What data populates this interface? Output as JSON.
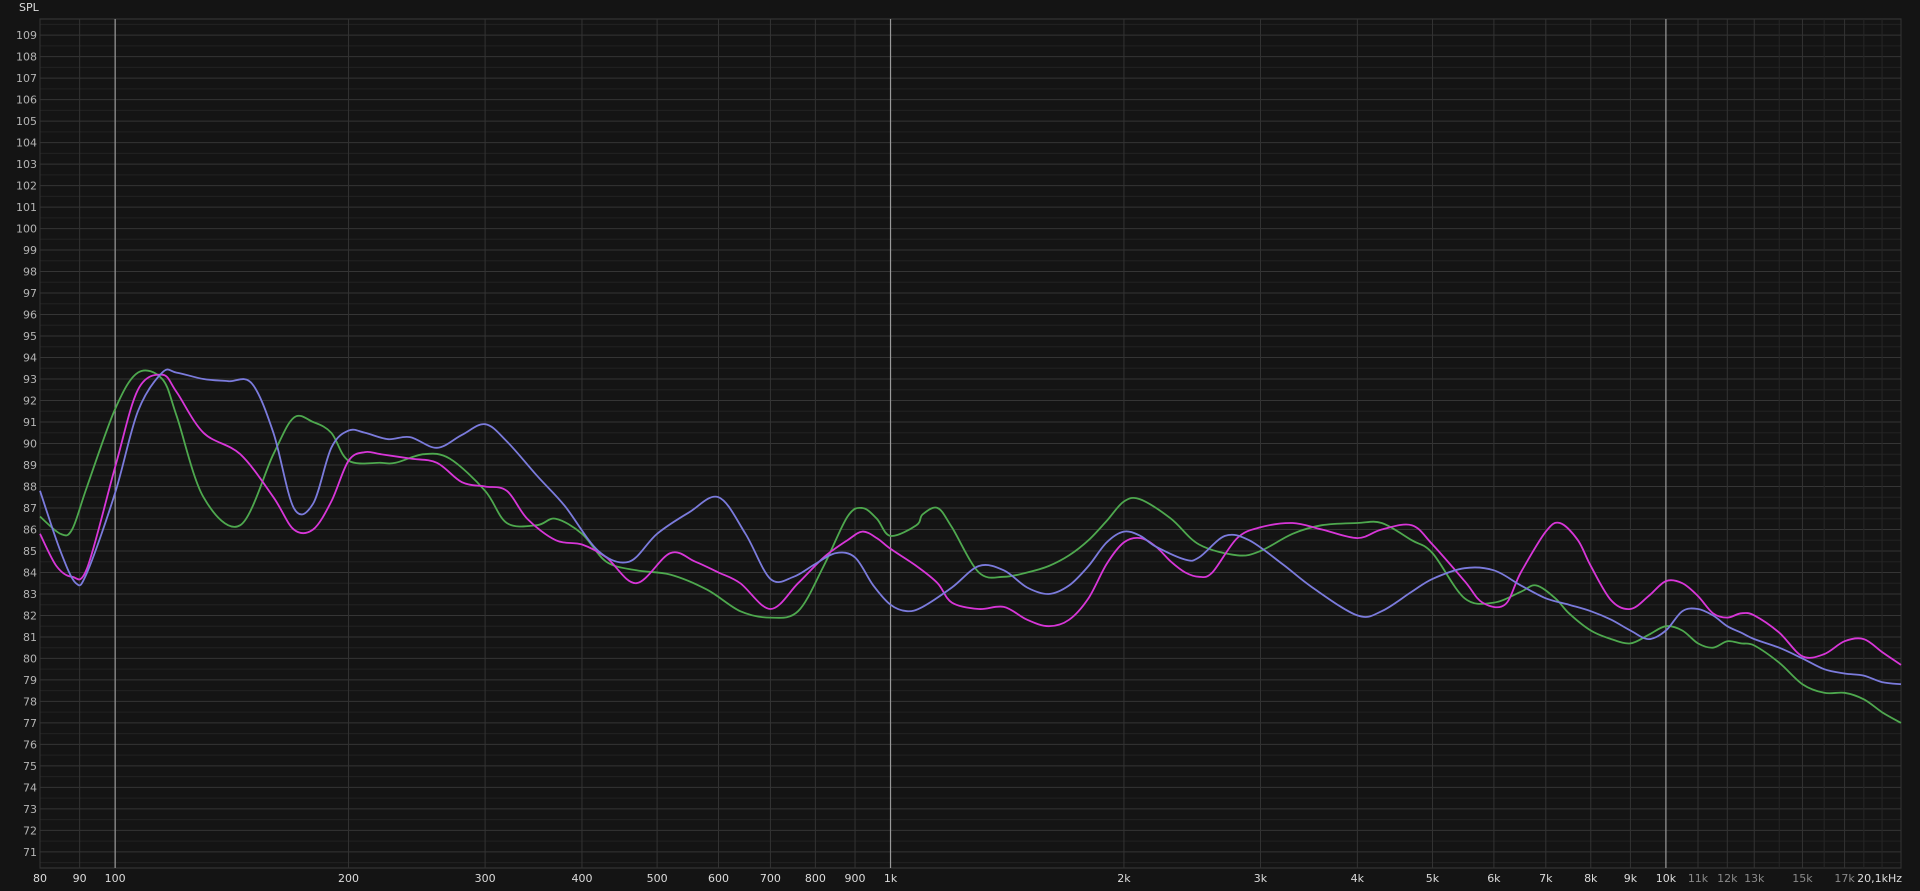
{
  "chart_data": {
    "type": "line",
    "ylabel": "SPL",
    "x_scale": "log",
    "xlim": [
      80,
      20100
    ],
    "ylim": [
      70,
      110
    ],
    "grid": true,
    "legend": "none",
    "y_ticks": [
      71,
      72,
      73,
      74,
      75,
      76,
      77,
      78,
      79,
      80,
      81,
      82,
      83,
      84,
      85,
      86,
      87,
      88,
      89,
      90,
      91,
      92,
      93,
      94,
      95,
      96,
      97,
      98,
      99,
      100,
      101,
      102,
      103,
      104,
      105,
      106,
      107,
      108,
      109
    ],
    "x_ticks": [
      {
        "v": 80,
        "label": "80",
        "major": true
      },
      {
        "v": 90,
        "label": "90",
        "major": true
      },
      {
        "v": 100,
        "label": "100",
        "major": true
      },
      {
        "v": 200,
        "label": "200",
        "major": true
      },
      {
        "v": 300,
        "label": "300",
        "major": true
      },
      {
        "v": 400,
        "label": "400",
        "major": true
      },
      {
        "v": 500,
        "label": "500",
        "major": true
      },
      {
        "v": 600,
        "label": "600",
        "major": true
      },
      {
        "v": 700,
        "label": "700",
        "major": true
      },
      {
        "v": 800,
        "label": "800",
        "major": true
      },
      {
        "v": 900,
        "label": "900",
        "major": true
      },
      {
        "v": 1000,
        "label": "1k",
        "major": true
      },
      {
        "v": 2000,
        "label": "2k",
        "major": true
      },
      {
        "v": 3000,
        "label": "3k",
        "major": true
      },
      {
        "v": 4000,
        "label": "4k",
        "major": true
      },
      {
        "v": 5000,
        "label": "5k",
        "major": true
      },
      {
        "v": 6000,
        "label": "6k",
        "major": true
      },
      {
        "v": 7000,
        "label": "7k",
        "major": true
      },
      {
        "v": 8000,
        "label": "8k",
        "major": true
      },
      {
        "v": 9000,
        "label": "9k",
        "major": true
      },
      {
        "v": 10000,
        "label": "10k",
        "major": true
      },
      {
        "v": 11000,
        "label": "11k",
        "major": false
      },
      {
        "v": 12000,
        "label": "12k",
        "major": false
      },
      {
        "v": 13000,
        "label": "13k",
        "major": false
      },
      {
        "v": 15000,
        "label": "15k",
        "major": false
      },
      {
        "v": 17000,
        "label": "17k",
        "major": false
      },
      {
        "v": 20100,
        "label": "20,1kHz",
        "major": true
      }
    ],
    "decade_lines": [
      100,
      1000,
      10000
    ],
    "series": [
      {
        "color": "#4ea84e",
        "x": [
          80,
          85,
          88,
          92,
          100,
          107,
          115,
          120,
          130,
          145,
          160,
          170,
          180,
          190,
          200,
          220,
          230,
          250,
          270,
          300,
          320,
          350,
          370,
          400,
          430,
          470,
          520,
          580,
          640,
          700,
          760,
          820,
          880,
          920,
          960,
          1000,
          1080,
          1100,
          1150,
          1200,
          1300,
          1400,
          1500,
          1600,
          1700,
          1800,
          1900,
          2000,
          2100,
          2300,
          2500,
          2800,
          3000,
          3300,
          3600,
          4000,
          4300,
          4700,
          5000,
          5500,
          6000,
          6500,
          6800,
          7200,
          7500,
          8000,
          8500,
          9000,
          9500,
          10000,
          10500,
          11000,
          11500,
          12000,
          12500,
          13000,
          14000,
          15000,
          16000,
          17000,
          18000,
          19000,
          20100
        ],
        "y": [
          86.6,
          85.8,
          86,
          88,
          91.6,
          93.3,
          93,
          91.3,
          87.5,
          86.2,
          89.5,
          91.2,
          91,
          90.5,
          89.2,
          89.1,
          89.1,
          89.5,
          89.3,
          87.8,
          86.3,
          86.2,
          86.5,
          85.8,
          84.5,
          84.1,
          83.9,
          83.2,
          82.2,
          81.9,
          82.2,
          84.3,
          86.6,
          87,
          86.5,
          85.7,
          86.2,
          86.7,
          87,
          86.1,
          84,
          83.8,
          84,
          84.3,
          84.8,
          85.5,
          86.4,
          87.3,
          87.4,
          86.5,
          85.3,
          84.8,
          85,
          85.8,
          86.2,
          86.3,
          86.3,
          85.5,
          84.9,
          82.8,
          82.6,
          83.1,
          83.4,
          82.8,
          82.1,
          81.3,
          80.9,
          80.7,
          81.1,
          81.5,
          81.3,
          80.7,
          80.5,
          80.8,
          80.7,
          80.6,
          79.8,
          78.8,
          78.4,
          78.4,
          78.1,
          77.5,
          77
        ]
      },
      {
        "color": "#d836d8",
        "x": [
          80,
          84,
          88,
          92,
          100,
          107,
          115,
          120,
          130,
          145,
          160,
          170,
          180,
          190,
          200,
          210,
          220,
          240,
          260,
          280,
          300,
          320,
          340,
          370,
          400,
          430,
          470,
          520,
          560,
          600,
          640,
          700,
          760,
          820,
          880,
          920,
          960,
          1000,
          1080,
          1150,
          1200,
          1300,
          1400,
          1500,
          1600,
          1700,
          1800,
          1900,
          2000,
          2100,
          2200,
          2300,
          2400,
          2500,
          2600,
          2800,
          3000,
          3300,
          3600,
          4000,
          4300,
          4700,
          5000,
          5500,
          5800,
          6200,
          6500,
          7000,
          7300,
          7700,
          8000,
          8500,
          9000,
          9500,
          10000,
          10500,
          11000,
          11500,
          12000,
          12500,
          13000,
          14000,
          15000,
          16000,
          17000,
          18000,
          19000,
          20100
        ],
        "y": [
          85.8,
          84.3,
          83.8,
          84.2,
          88.9,
          92.5,
          93.2,
          92.4,
          90.5,
          89.5,
          87.5,
          86,
          86,
          87.3,
          89.2,
          89.6,
          89.5,
          89.3,
          89.1,
          88.2,
          88,
          87.8,
          86.5,
          85.5,
          85.3,
          84.7,
          83.5,
          84.9,
          84.5,
          84,
          83.5,
          82.3,
          83.5,
          84.7,
          85.5,
          85.9,
          85.6,
          85.1,
          84.3,
          83.5,
          82.6,
          82.3,
          82.4,
          81.8,
          81.5,
          81.8,
          82.8,
          84.4,
          85.4,
          85.6,
          85.2,
          84.5,
          84,
          83.8,
          84,
          85.6,
          86.1,
          86.3,
          86,
          85.6,
          86,
          86.2,
          85.3,
          83.6,
          82.6,
          82.5,
          84,
          85.9,
          86.3,
          85.5,
          84.3,
          82.7,
          82.3,
          82.9,
          83.6,
          83.5,
          82.9,
          82.1,
          81.9,
          82.1,
          82,
          81.2,
          80.1,
          80.2,
          80.8,
          80.9,
          80.3,
          79.7
        ]
      },
      {
        "color": "#7b7bdc",
        "x": [
          80,
          85,
          89,
          92,
          100,
          107,
          115,
          120,
          130,
          140,
          150,
          160,
          170,
          180,
          190,
          200,
          210,
          225,
          240,
          260,
          280,
          300,
          320,
          350,
          380,
          420,
          460,
          500,
          550,
          600,
          650,
          700,
          750,
          800,
          850,
          900,
          950,
          1000,
          1050,
          1100,
          1200,
          1300,
          1400,
          1500,
          1600,
          1700,
          1800,
          1900,
          2000,
          2100,
          2200,
          2400,
          2500,
          2700,
          2900,
          3200,
          3500,
          4000,
          4300,
          4700,
          5000,
          5500,
          6000,
          6500,
          7000,
          7500,
          8000,
          8500,
          9000,
          9500,
          10000,
          10500,
          11000,
          11500,
          12000,
          12500,
          13000,
          14000,
          15000,
          16000,
          17000,
          18000,
          19000,
          20100
        ],
        "y": [
          87.8,
          85,
          83.5,
          84,
          87.7,
          91.5,
          93.3,
          93.3,
          93,
          92.9,
          92.8,
          90.5,
          87,
          87.2,
          89.8,
          90.6,
          90.5,
          90.2,
          90.3,
          89.8,
          90.4,
          90.9,
          90.1,
          88.5,
          87.1,
          85,
          84.5,
          85.8,
          86.8,
          87.5,
          85.8,
          83.7,
          83.8,
          84.4,
          84.9,
          84.7,
          83.4,
          82.5,
          82.2,
          82.4,
          83.3,
          84.3,
          84.1,
          83.3,
          83,
          83.4,
          84.3,
          85.4,
          85.9,
          85.7,
          85.2,
          84.6,
          84.7,
          85.7,
          85.5,
          84.4,
          83.3,
          82,
          82.2,
          83.1,
          83.7,
          84.2,
          84.1,
          83.4,
          82.8,
          82.5,
          82.2,
          81.8,
          81.3,
          80.9,
          81.3,
          82.2,
          82.3,
          82,
          81.5,
          81.2,
          80.9,
          80.5,
          80,
          79.5,
          79.3,
          79.2,
          78.9,
          78.8
        ]
      }
    ]
  }
}
